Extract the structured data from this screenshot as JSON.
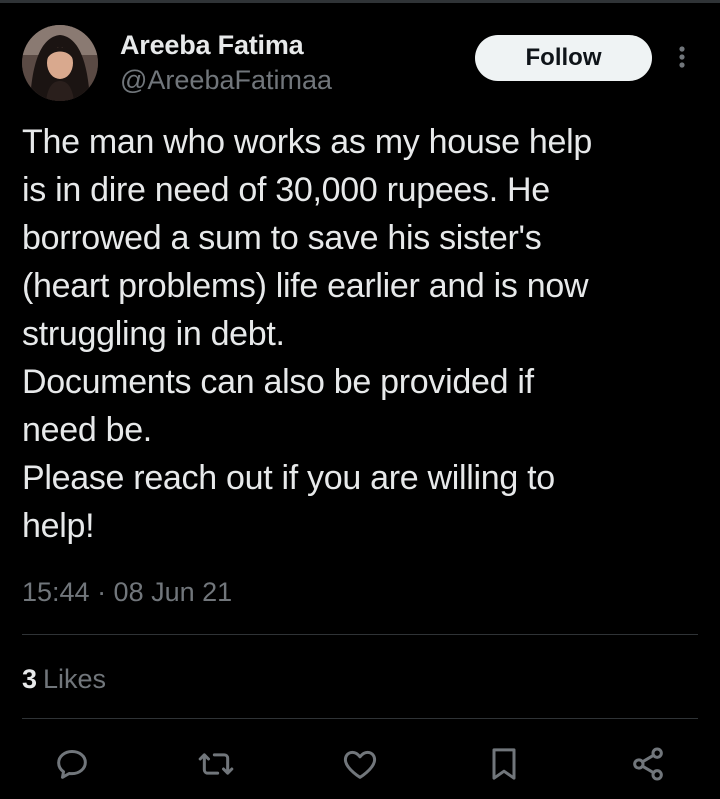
{
  "author": {
    "display_name": "Areeba Fatima",
    "handle": "@AreebaFatimaa"
  },
  "follow_label": "Follow",
  "tweet": {
    "lines": [
      "The man who works as my house help",
      "is in dire need of 30,000 rupees. He",
      "borrowed a sum to save his sister's",
      "(heart problems) life earlier and is now",
      "struggling in debt.",
      "Documents can also be provided if",
      "need be.",
      "Please reach out if you are willing to",
      "help!"
    ]
  },
  "timestamp": "15:44 · 08 Jun 21",
  "stats": {
    "likes_count": "3",
    "likes_label": "Likes"
  },
  "icons": {
    "more": "more-vertical-icon",
    "reply": "reply-icon",
    "retweet": "retweet-icon",
    "like": "heart-icon",
    "bookmark": "bookmark-icon",
    "share": "share-icon"
  },
  "colors": {
    "background": "#000000",
    "text": "#e7e9ea",
    "secondary": "#71767b",
    "divider": "#2f3336",
    "follow_bg": "#eff3f4"
  }
}
